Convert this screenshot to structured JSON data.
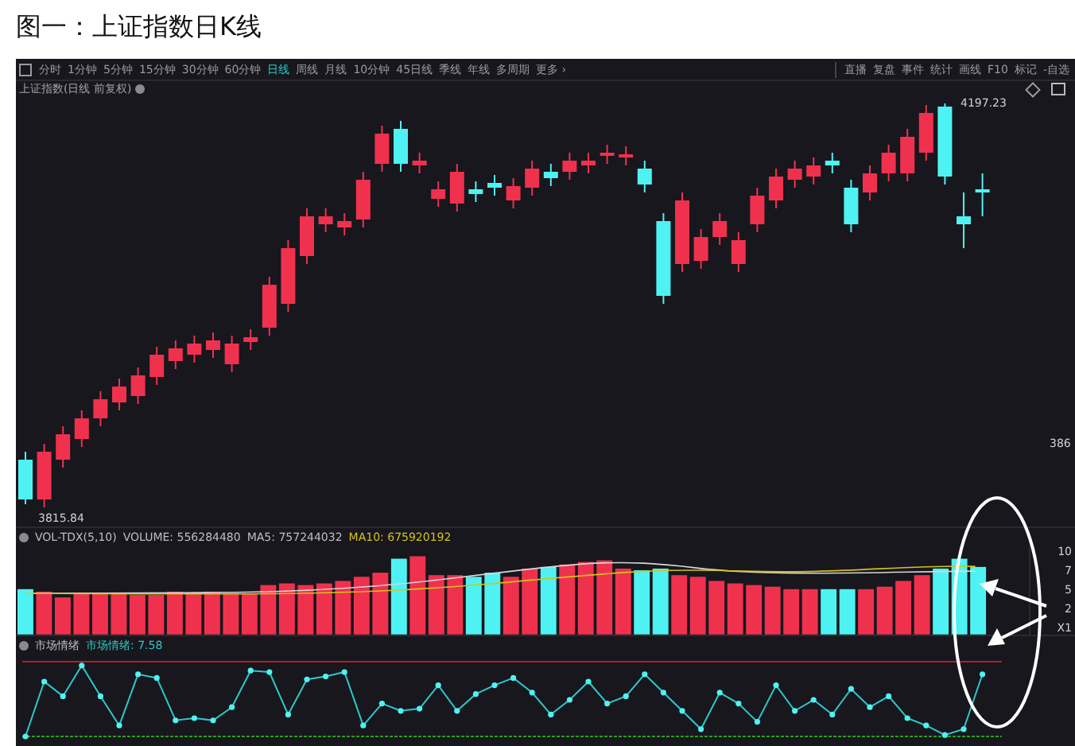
{
  "caption": "图一：上证指数日K线",
  "toolbar": {
    "periods": [
      {
        "label": "分时",
        "selected": false
      },
      {
        "label": "1分钟",
        "selected": false
      },
      {
        "label": "5分钟",
        "selected": false
      },
      {
        "label": "15分钟",
        "selected": false
      },
      {
        "label": "30分钟",
        "selected": false
      },
      {
        "label": "60分钟",
        "selected": false
      },
      {
        "label": "日线",
        "selected": true
      },
      {
        "label": "周线",
        "selected": false
      },
      {
        "label": "月线",
        "selected": false
      },
      {
        "label": "10分钟",
        "selected": false
      },
      {
        "label": "45日线",
        "selected": false
      },
      {
        "label": "季线",
        "selected": false
      },
      {
        "label": "年线",
        "selected": false
      },
      {
        "label": "多周期",
        "selected": false
      },
      {
        "label": "更多 ›",
        "selected": false
      }
    ],
    "tools": [
      "直播",
      "复盘",
      "事件",
      "统计",
      "画线",
      "F10",
      "标记",
      "-自选"
    ]
  },
  "kline": {
    "title": "上证指数(日线 前复权)",
    "high_label": "4197.23",
    "low_label": "3815.84",
    "axis_label": "386",
    "chart_data": {
      "type": "candlestick",
      "ohlc": [
        [
          3860.89,
          3868.4,
          3818.85,
          3823.36
        ],
        [
          3823.36,
          3875.91,
          3815.84,
          3868.4
        ],
        [
          3860.89,
          3892.43,
          3853.39,
          3884.92
        ],
        [
          3880.41,
          3907.44,
          3872.91,
          3899.93
        ],
        [
          3899.93,
          3925.46,
          3892.43,
          3917.95
        ],
        [
          3914.95,
          3937.47,
          3907.44,
          3929.96
        ],
        [
          3920.95,
          3947.98,
          3913.45,
          3940.47
        ],
        [
          3938.97,
          3967.5,
          3931.46,
          3959.99
        ],
        [
          3953.99,
          3973.51,
          3946.48,
          3965.99
        ],
        [
          3959.99,
          3978.01,
          3952.49,
          3970.5
        ],
        [
          3964.5,
          3981.01,
          3956.99,
          3973.51
        ],
        [
          3950.98,
          3978.01,
          3943.48,
          3970.5
        ],
        [
          3972.01,
          3984.02,
          3964.5,
          3976.51
        ],
        [
          3985.52,
          4033.57,
          3978.01,
          4026.06
        ],
        [
          4008.04,
          4068.1,
          4000.53,
          4060.59
        ],
        [
          4053.09,
          4098.13,
          4045.58,
          4090.62
        ],
        [
          4083.12,
          4098.13,
          4075.61,
          4090.62
        ],
        [
          4080.11,
          4093.63,
          4072.61,
          4086.12
        ],
        [
          4087.62,
          4132.66,
          4080.11,
          4125.16
        ],
        [
          4140.17,
          4176.21,
          4132.66,
          4168.7
        ],
        [
          4173.21,
          4180.71,
          4132.66,
          4140.17
        ],
        [
          4138.67,
          4150.68,
          4131.16,
          4143.17
        ],
        [
          4107.14,
          4123.66,
          4099.63,
          4116.15
        ],
        [
          4102.64,
          4140.17,
          4095.13,
          4132.66
        ],
        [
          4116.15,
          4123.66,
          4104.14,
          4111.64
        ],
        [
          4122.16,
          4129.66,
          4110.14,
          4117.65
        ],
        [
          4105.64,
          4126.66,
          4098.13,
          4119.15
        ],
        [
          4117.65,
          4143.17,
          4110.14,
          4135.67
        ],
        [
          4132.66,
          4140.17,
          4119.15,
          4126.66
        ],
        [
          4132.66,
          4150.68,
          4125.16,
          4143.17
        ],
        [
          4138.67,
          4150.68,
          4131.16,
          4143.17
        ],
        [
          4147.68,
          4158.19,
          4140.17,
          4150.68
        ],
        [
          4146.18,
          4156.69,
          4138.67,
          4149.18
        ],
        [
          4135.67,
          4143.17,
          4113.15,
          4120.65
        ],
        [
          4086.12,
          4093.63,
          4008.04,
          4015.55
        ],
        [
          4045.58,
          4113.15,
          4038.07,
          4105.64
        ],
        [
          4048.58,
          4078.61,
          4041.07,
          4071.1
        ],
        [
          4071.1,
          4093.63,
          4063.6,
          4086.12
        ],
        [
          4045.58,
          4075.61,
          4038.07,
          4068.1
        ],
        [
          4083.12,
          4117.65,
          4075.61,
          4110.14
        ],
        [
          4105.64,
          4135.67,
          4098.13,
          4128.16
        ],
        [
          4125.16,
          4143.17,
          4117.65,
          4135.67
        ],
        [
          4128.16,
          4146.18,
          4120.65,
          4138.67
        ],
        [
          4143.17,
          4150.68,
          4131.16,
          4138.67
        ],
        [
          4117.65,
          4125.16,
          4075.61,
          4083.12
        ],
        [
          4113.15,
          4138.67,
          4105.64,
          4131.16
        ],
        [
          4131.16,
          4158.19,
          4123.66,
          4150.68
        ],
        [
          4131.16,
          4173.21,
          4123.66,
          4165.7
        ],
        [
          4150.68,
          4195.73,
          4143.17,
          4188.22
        ],
        [
          4194.23,
          4197.23,
          4120.65,
          4128.16
        ],
        [
          4090.62,
          4113.15,
          4060.59,
          4083.12
        ],
        [
          4116.15,
          4131.16,
          4090.62,
          4113.15
        ]
      ]
    }
  },
  "volume": {
    "indicator": "VOL-TDX(5,10)",
    "volume": "VOLUME: 556284480",
    "ma5": "MA5: 757244032",
    "ma10": "MA10: 675920192",
    "axis_labels": [
      "10",
      "7",
      "5",
      "2",
      "X1"
    ]
  },
  "sentiment": {
    "name": "市场情绪",
    "value": "市场情绪: 7.58"
  }
}
